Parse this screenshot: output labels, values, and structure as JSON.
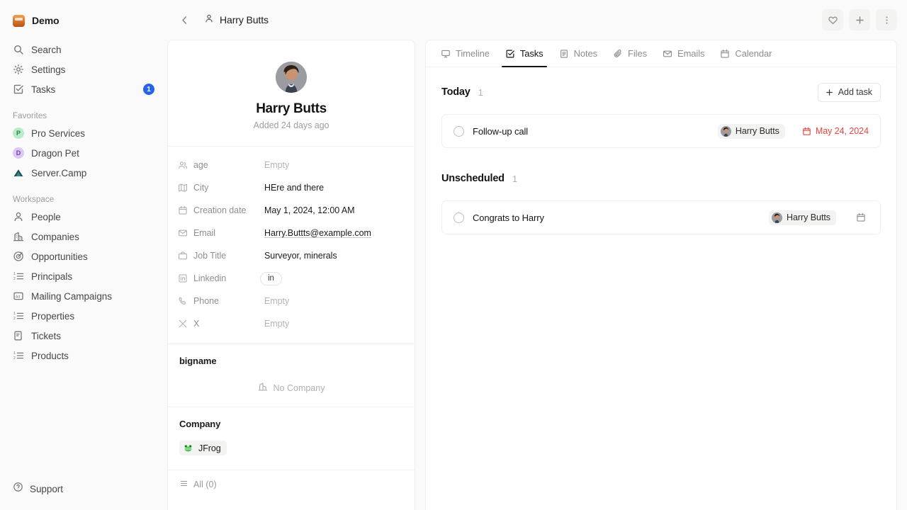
{
  "sidebar": {
    "workspace": {
      "name": "Demo",
      "icon": "workspace-logo"
    },
    "nav": [
      {
        "label": "Search",
        "icon": "search-icon"
      },
      {
        "label": "Settings",
        "icon": "gear-icon"
      },
      {
        "label": "Tasks",
        "icon": "checkbox-icon",
        "badge": "1"
      }
    ],
    "favorites_label": "Favorites",
    "favorites": [
      {
        "label": "Pro Services",
        "initial": "P",
        "color": "#b9ecc8"
      },
      {
        "label": "Dragon Pet",
        "initial": "D",
        "color": "#dcc8f5"
      },
      {
        "label": "Server.Camp",
        "icon": "tent-icon",
        "color": "#1f4f57"
      }
    ],
    "workspace_label": "Workspace",
    "workspace_items": [
      {
        "label": "People",
        "icon": "person-icon"
      },
      {
        "label": "Companies",
        "icon": "building-icon"
      },
      {
        "label": "Opportunities",
        "icon": "target-icon"
      },
      {
        "label": "Principals",
        "icon": "ordered-list-icon"
      },
      {
        "label": "Mailing Campaigns",
        "icon": "ad-icon"
      },
      {
        "label": "Properties",
        "icon": "ordered-list-icon"
      },
      {
        "label": "Tickets",
        "icon": "ticket-icon"
      },
      {
        "label": "Products",
        "icon": "ordered-list-icon"
      }
    ],
    "support": {
      "label": "Support",
      "icon": "help-circle-icon"
    }
  },
  "topbar": {
    "back_icon": "chevron-left-icon",
    "breadcrumb_icon": "person-icon",
    "breadcrumb": "Harry Butts",
    "actions": [
      {
        "name": "favorite-button",
        "icon": "heart-icon"
      },
      {
        "name": "add-button",
        "icon": "plus-icon"
      },
      {
        "name": "more-options-button",
        "icon": "more-vertical-icon"
      }
    ]
  },
  "record": {
    "name": "Harry Butts",
    "added": "Added 24 days ago",
    "avatar": "person-photo",
    "fields": [
      {
        "label": "age",
        "icon": "people-icon",
        "value": "Empty",
        "empty": true
      },
      {
        "label": "City",
        "icon": "map-icon",
        "value": "HEre and there",
        "empty": false
      },
      {
        "label": "Creation date",
        "icon": "calendar-icon",
        "value": "May 1, 2024, 12:00 AM",
        "empty": false
      },
      {
        "label": "Email",
        "icon": "envelope-icon",
        "value": "Harry.Buttts@example.com",
        "empty": false,
        "link": true
      },
      {
        "label": "Job Title",
        "icon": "briefcase-icon",
        "value": "Surveyor, minerals",
        "empty": false
      },
      {
        "label": "Linkedin",
        "icon": "linkedin-icon",
        "value": "in",
        "chip": true
      },
      {
        "label": "Phone",
        "icon": "phone-icon",
        "value": "Empty",
        "empty": true
      },
      {
        "label": "X",
        "icon": "x-icon",
        "value": "Empty",
        "empty": true
      }
    ],
    "bigname_section": {
      "title": "bigname",
      "empty_text": "No Company",
      "empty_icon": "building-icon"
    },
    "company_section": {
      "title": "Company",
      "chip_label": "JFrog",
      "chip_icon": "jfrog-logo"
    },
    "cut_section": {
      "label": "All (0)",
      "icon": "list-icon"
    }
  },
  "tabs": [
    {
      "label": "Timeline",
      "icon": "monitor-icon",
      "active": false
    },
    {
      "label": "Tasks",
      "icon": "checkbox-icon",
      "active": true
    },
    {
      "label": "Notes",
      "icon": "note-icon",
      "active": false
    },
    {
      "label": "Files",
      "icon": "paperclip-icon",
      "active": false
    },
    {
      "label": "Emails",
      "icon": "envelope-icon",
      "active": false
    },
    {
      "label": "Calendar",
      "icon": "calendar-icon",
      "active": false
    }
  ],
  "tasks": {
    "add_task_label": "Add task",
    "add_task_icon": "plus-icon",
    "groups": [
      {
        "title": "Today",
        "count": "1",
        "items": [
          {
            "title": "Follow-up call",
            "assignee": "Harry Butts",
            "due": "May 24, 2024",
            "due_overdue": true,
            "due_icon": "calendar-icon",
            "checkbox": "circle-unchecked"
          }
        ]
      },
      {
        "title": "Unscheduled",
        "count": "1",
        "items": [
          {
            "title": "Congrats to Harry",
            "assignee": "Harry Butts",
            "due": "",
            "due_overdue": false,
            "due_icon": "calendar-icon",
            "checkbox": "circle-unchecked"
          }
        ]
      }
    ]
  },
  "colors": {
    "accent_blue": "#2563eb",
    "overdue_red": "#e8453c",
    "active_tab": "#141414",
    "sidebar_bg": "#fafafa"
  }
}
